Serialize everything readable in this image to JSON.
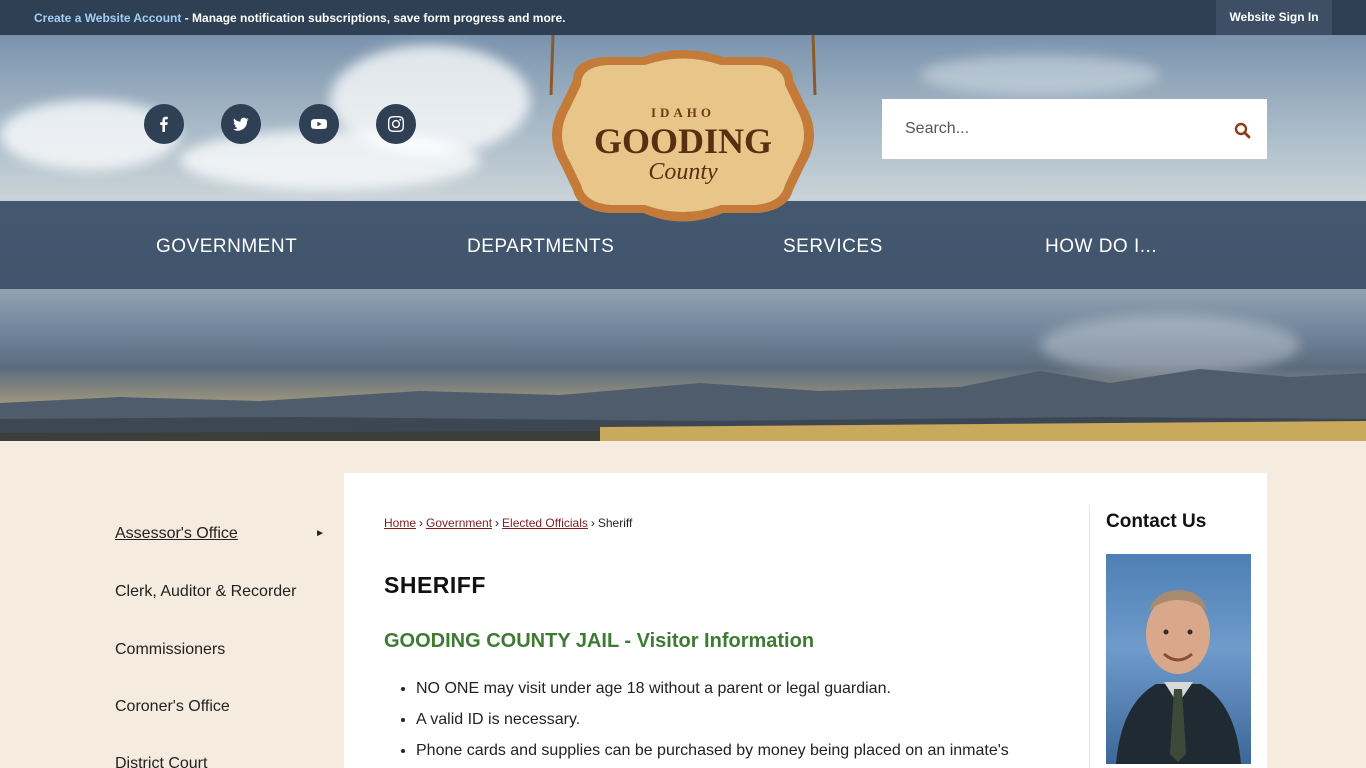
{
  "topbar": {
    "create_account_link": "Create a Website Account",
    "promo_text": " - Manage notification subscriptions, save form progress and more.",
    "signin_label": "Website Sign In"
  },
  "social": [
    "facebook-icon",
    "twitter-icon",
    "youtube-icon",
    "instagram-icon"
  ],
  "logo": {
    "state": "IDAHO",
    "name": "GOODING",
    "tagline": "County"
  },
  "search": {
    "placeholder": "Search..."
  },
  "nav": {
    "items": [
      "GOVERNMENT",
      "DEPARTMENTS",
      "SERVICES",
      "HOW DO I..."
    ]
  },
  "sidebar": {
    "items": [
      "Assessor's Office",
      "Clerk, Auditor & Recorder",
      "Commissioners",
      "Coroner's Office",
      "District Court"
    ]
  },
  "breadcrumb": {
    "home": "Home",
    "government": "Government",
    "elected": "Elected Officials",
    "current": "Sheriff",
    "sep": "›"
  },
  "page": {
    "title": "SHERIFF",
    "subtitle": "GOODING COUNTY JAIL - Visitor Information",
    "bullets": [
      "NO ONE may visit under age 18 without a parent or legal guardian.",
      "A valid ID is necessary.",
      "Phone cards and supplies can be purchased by money being placed on an inmate's"
    ]
  },
  "contact": {
    "title": "Contact Us"
  },
  "colors": {
    "topbar": "#2f3f54",
    "nav": "#384d66",
    "accent_green": "#3f7a34",
    "link": "#7b1f1f",
    "page_bg": "#f5ebde"
  }
}
